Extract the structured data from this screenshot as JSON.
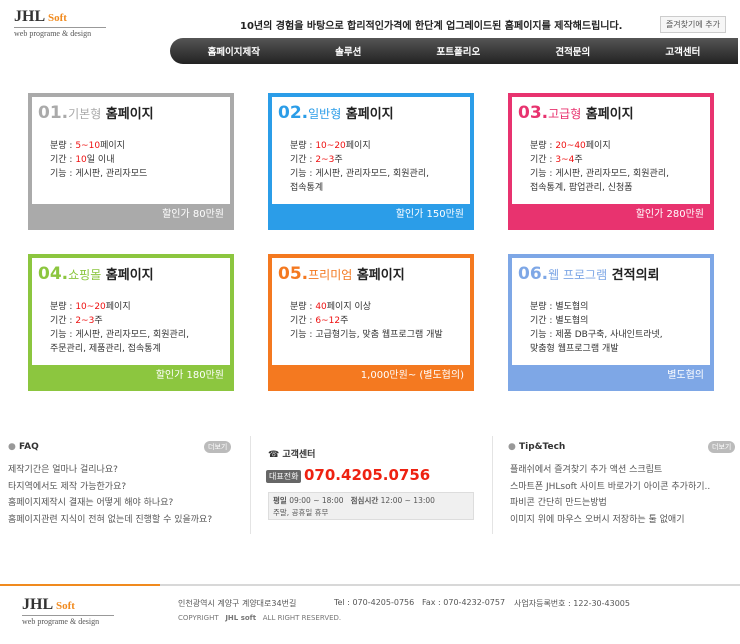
{
  "logo": {
    "jhl": "JHL",
    "soft": "Soft",
    "tagline": "web programe & design"
  },
  "headline": "10년의 경험을 바탕으로 합리적인가격에 한단계 업그레이드된 홈페이지를 제작해드립니다.",
  "fav_button": "즐겨찾기에 추가",
  "nav": [
    "홈페이지제작",
    "솔루션",
    "포트폴리오",
    "견적문의",
    "고객센터"
  ],
  "cards": [
    {
      "num": "01.",
      "type": "기본형",
      "title": "홈페이지",
      "color": "#aaaaaa",
      "lines": [
        [
          "분량 : ",
          "5~10",
          "페이지"
        ],
        [
          "기간 : ",
          "10",
          "일 이내"
        ],
        [
          "기능 : 게시판, 관리자모드",
          "",
          ""
        ]
      ],
      "price": "할인가 80만원"
    },
    {
      "num": "02.",
      "type": "일반형",
      "title": "홈페이지",
      "color": "#2b9de8",
      "lines": [
        [
          "분량 : ",
          "10~20",
          "페이지"
        ],
        [
          "기간 : ",
          "2~3",
          "주"
        ],
        [
          "기능 : 게시판, 관리자모드, 회원관리,",
          "",
          ""
        ],
        [
          "       접속통계",
          "",
          ""
        ]
      ],
      "price": "할인가 150만원"
    },
    {
      "num": "03.",
      "type": "고급형",
      "title": "홈페이지",
      "color": "#e8336f",
      "lines": [
        [
          "분량 : ",
          "20~40",
          "페이지"
        ],
        [
          "기간 : ",
          "3~4",
          "주"
        ],
        [
          "기능 : 게시판, 관리자모드, 회원관리,",
          "",
          ""
        ],
        [
          "       접속통계, 팝업관리, 신청폼",
          "",
          ""
        ]
      ],
      "price": "할인가 280만원"
    },
    {
      "num": "04.",
      "type": "쇼핑몰",
      "title": "홈페이지",
      "color": "#8cc63f",
      "lines": [
        [
          "분량 : ",
          "10~20",
          "페이지"
        ],
        [
          "기간 : ",
          "2~3",
          "주"
        ],
        [
          "기능 : 게시판, 관리자모드, 회원관리,",
          "",
          ""
        ],
        [
          "       주문관리, 제품관리, 접속통계",
          "",
          ""
        ]
      ],
      "price": "할인가 180만원"
    },
    {
      "num": "05.",
      "type": "프리미엄",
      "title": "홈페이지",
      "color": "#f47920",
      "lines": [
        [
          "분량 : ",
          "40",
          "페이지 이상"
        ],
        [
          "기간 : ",
          "6~12",
          "주"
        ],
        [
          "기능 : 고급형기능, 맞춤 웹프로그램 개발",
          "",
          ""
        ]
      ],
      "price": "1,000만원~ (별도협의)"
    },
    {
      "num": "06.",
      "type": "웹 프로그램",
      "title": "견적의뢰",
      "color": "#7ea7e6",
      "lines": [
        [
          "분량 : 별도협의",
          "",
          ""
        ],
        [
          "기간 : 별도협의",
          "",
          ""
        ],
        [
          "기능 : 제품 DB구축, 사내인트라넷,",
          "",
          ""
        ],
        [
          "       맞춤형 웹프로그램 개발",
          "",
          ""
        ]
      ],
      "price": "별도협의"
    }
  ],
  "faq": {
    "title": "FAQ",
    "more": "더보기",
    "items": [
      "제작기간은 얼마나 걸리나요?",
      "타지역에서도 제작 가능한가요?",
      "홈페이지제작시 결재는 어떻게 해야 하나요?",
      "홈페이지관련 지식이 전혀 없는데 진행할 수 있을까요?"
    ]
  },
  "cs": {
    "title": "고객센터",
    "badge": "대표전화",
    "phone": "070.4205.0756",
    "hours_label1": "평일",
    "hours1": "09:00 ~ 18:00",
    "lunch_label": "점심시간",
    "lunch": "12:00 ~ 13:00",
    "closed": "주말, 공휴일 휴무"
  },
  "tip": {
    "title": "Tip&Tech",
    "more": "더보기",
    "items": [
      "플래쉬에서 즐겨찾기 추가 액션 스크립트",
      "스마트폰 JHLsoft 사이트 바로가기 아이콘 추가하기..",
      "파비콘 간단히 만드는방법",
      "이미지 위에 마우스 오버시 저장하는 툴 없애기"
    ]
  },
  "footer": {
    "address": "인천광역시 계양구 계양대로34번길",
    "tel": "Tel : 070-4205-0756",
    "fax": "Fax : 070-4232-0757",
    "biz": "사업자등록번호 : 122-30-43005",
    "copyright": "COPYRIGHT",
    "brand": "JHL soft",
    "rights": "ALL RIGHT RESERVED."
  }
}
